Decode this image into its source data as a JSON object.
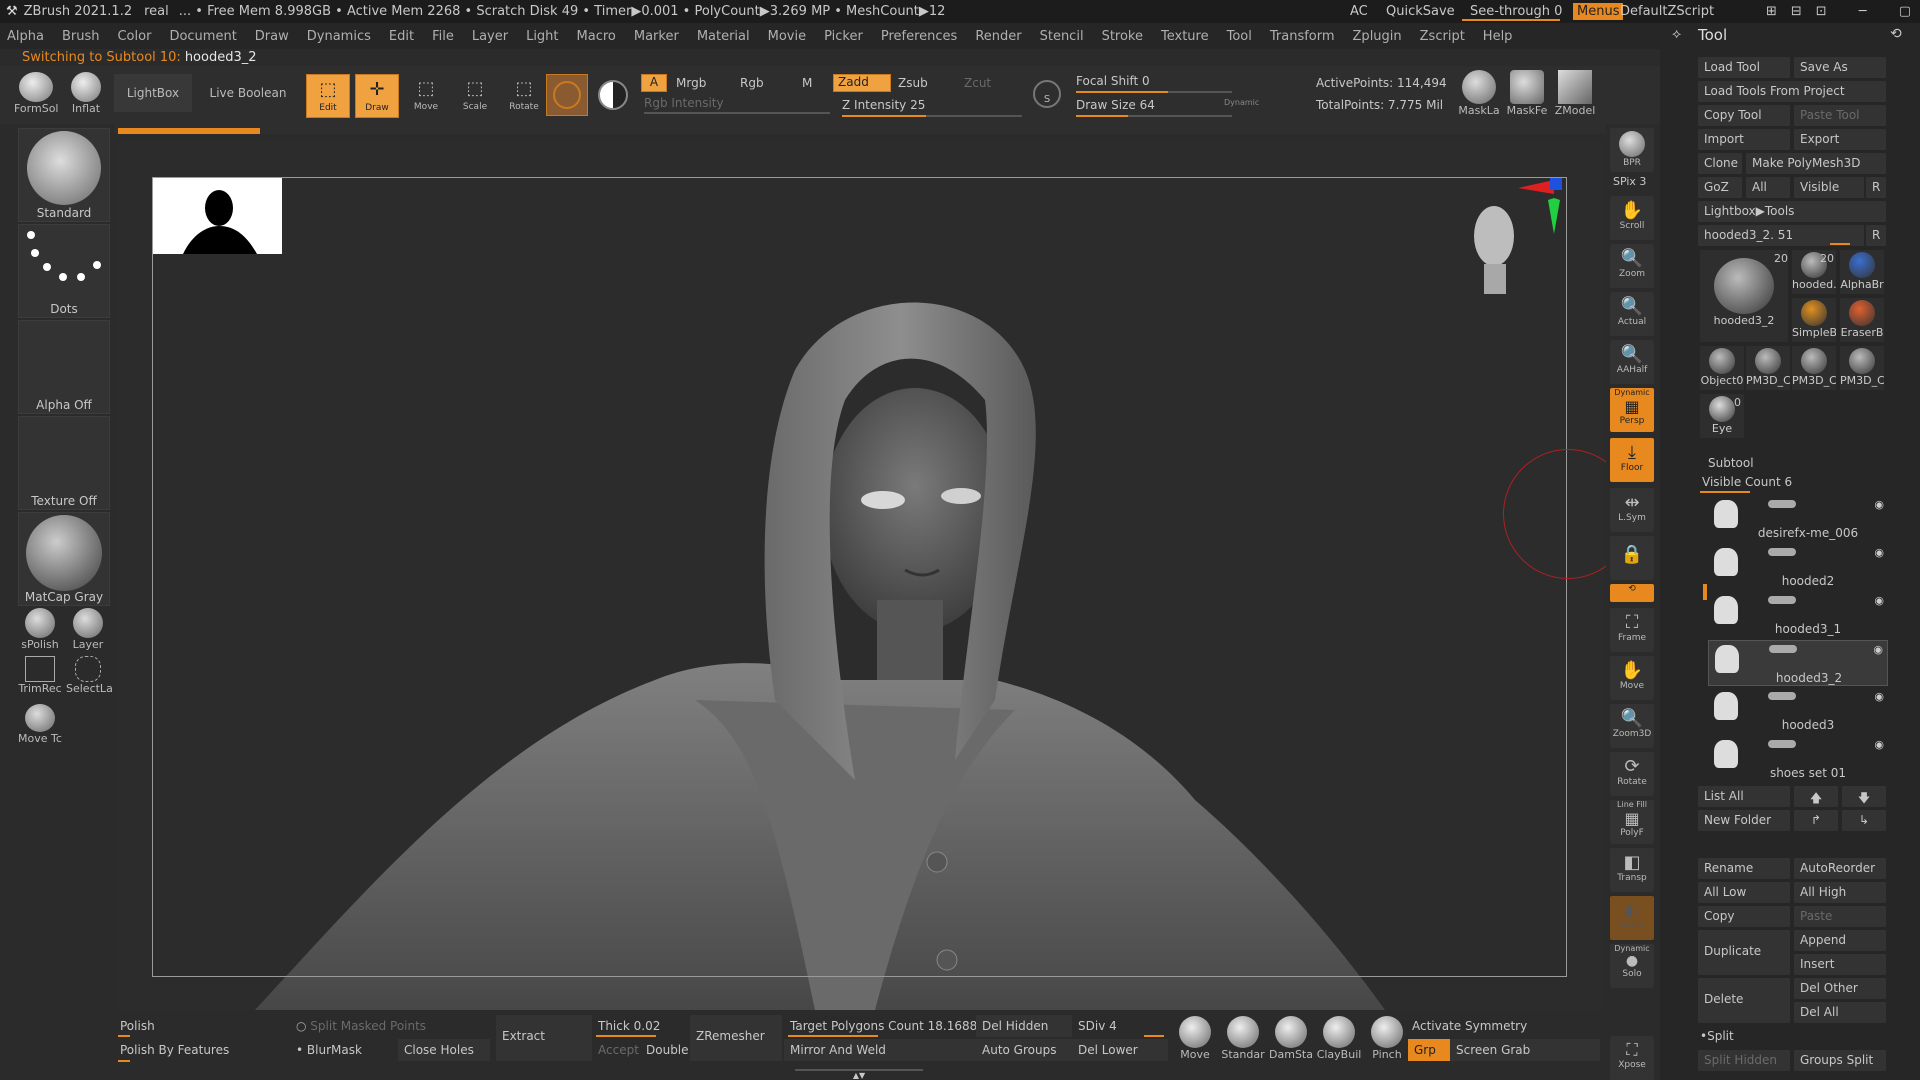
{
  "title_bar": {
    "app": "ZBrush 2021.1.2",
    "doc": "real",
    "stats": "... • Free Mem 8.998GB • Active Mem 2268 • Scratch Disk 49 • Timer▶0.001 • PolyCount▶3.269 MP • MeshCount▶12",
    "ac": "AC",
    "quicksave": "QuickSave",
    "seethrough": "See-through 0",
    "menus": "Menus",
    "script": "DefaultZScript"
  },
  "menu": [
    "Alpha",
    "Brush",
    "Color",
    "Document",
    "Draw",
    "Dynamics",
    "Edit",
    "File",
    "Layer",
    "Light",
    "Macro",
    "Marker",
    "Material",
    "Movie",
    "Picker",
    "Preferences",
    "Render",
    "Stencil",
    "Stroke",
    "Texture",
    "Tool",
    "Transform",
    "Zplugin",
    "Zscript",
    "Help"
  ],
  "notice": {
    "prefix": "Switching to Subtool 10:",
    "name": "hooded3_2"
  },
  "shelf": {
    "formsol": "FormSol",
    "inflat": "Inflat",
    "lightbox": "LightBox",
    "live_boolean": "Live Boolean",
    "edit": "Edit",
    "draw": "Draw",
    "move": "Move",
    "scale": "Scale",
    "rotate": "Rotate",
    "a": "A",
    "mrgb": "Mrgb",
    "rgb": "Rgb",
    "m": "M",
    "rgb_intensity": "Rgb Intensity",
    "zadd": "Zadd",
    "zsub": "Zsub",
    "zcut": "Zcut",
    "z_intensity": "Z Intensity 25",
    "focal_shift": "Focal Shift 0",
    "draw_size": "Draw Size 64",
    "dynamic": "Dynamic",
    "active_points": "ActivePoints: 114,494",
    "total_points": "TotalPoints: 7.775 Mil",
    "maskla": "MaskLa",
    "maskfe": "MaskFe",
    "zmodel": "ZModel"
  },
  "left": {
    "standard": "Standard",
    "dots": "Dots",
    "alpha_off": "Alpha Off",
    "texture_off": "Texture Off",
    "matcap": "MatCap Gray",
    "spolish": "sPolish",
    "layer": "Layer",
    "trimrec": "TrimRec",
    "selectla": "SelectLa",
    "movetc": "Move Tc"
  },
  "right_shelf": {
    "bpr": "BPR",
    "spix": "SPix 3",
    "scroll": "Scroll",
    "zoom": "Zoom",
    "actual": "Actual",
    "aahalf": "AAHalf",
    "dynamic": "Dynamic",
    "persp": "Persp",
    "floor": "Floor",
    "lsym": "L.Sym",
    "frame": "Frame",
    "move": "Move",
    "zoom3d": "Zoom3D",
    "rotate": "Rotate",
    "linefill": "Line Fill",
    "polyf": "PolyF",
    "transp": "Transp",
    "ghost": "Ghost",
    "solo": "Solo",
    "xpose": "Xpose"
  },
  "tool": {
    "title": "Tool",
    "load_tool": "Load Tool",
    "save_as": "Save As",
    "load_from_project": "Load Tools From Project",
    "copy_tool": "Copy Tool",
    "paste_tool": "Paste Tool",
    "import": "Import",
    "export": "Export",
    "clone": "Clone",
    "make_polymesh": "Make PolyMesh3D",
    "goz": "GoZ",
    "all": "All",
    "visible": "Visible",
    "r": "R",
    "lightbox_tools": "Lightbox▶Tools",
    "current": "hooded3_2. 51",
    "thumbs": [
      "hooded3_2",
      "hooded.",
      "AlphaBr",
      "SimpleB",
      "EraserB",
      "Object0",
      "PM3D_C",
      "PM3D_C",
      "PM3D_C",
      "Eye"
    ],
    "thumb_count": "20",
    "eye_count": "0"
  },
  "subtool": {
    "title": "Subtool",
    "visible_count": "Visible Count 6",
    "items": [
      "desirefx-me_006",
      "hooded2",
      "hooded3_1",
      "hooded3_2",
      "hooded3",
      "shoes set 01"
    ],
    "list_all": "List All",
    "new_folder": "New Folder",
    "rename": "Rename",
    "autoreorder": "AutoReorder",
    "all_low": "All Low",
    "all_high": "All High",
    "copy": "Copy",
    "paste": "Paste",
    "duplicate": "Duplicate",
    "append": "Append",
    "insert": "Insert",
    "delete": "Delete",
    "del_other": "Del Other",
    "del_all": "Del All",
    "split": "Split",
    "split_hidden": "Split Hidden",
    "groups_split": "Groups Split"
  },
  "bottom": {
    "polish": "Polish",
    "polish_features": "Polish By Features",
    "split_masked": "Split Masked Points",
    "blurmask": "BlurMask",
    "close_holes": "Close Holes",
    "extract": "Extract",
    "thick": "Thick 0.02",
    "accept": "Accept",
    "double": "Double",
    "zremesher": "ZRemesher",
    "target": "Target Polygons Count 18.16884",
    "mirror": "Mirror And Weld",
    "del_hidden": "Del Hidden",
    "auto_groups": "Auto Groups",
    "sdiv": "SDiv 4",
    "del_lower": "Del Lower",
    "brushes": [
      "Move",
      "Standar",
      "DamSta",
      "ClayBuil",
      "Pinch"
    ],
    "activate_symmetry": "Activate Symmetry",
    "grp": "Grp",
    "screen_grab": "Screen Grab"
  }
}
